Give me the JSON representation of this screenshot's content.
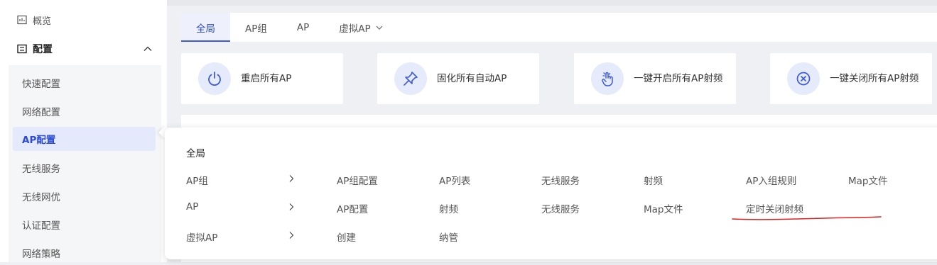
{
  "sidebar": {
    "overview_label": "概览",
    "config_group_label": "配置",
    "items": [
      {
        "label": "快速配置"
      },
      {
        "label": "网络配置"
      },
      {
        "label": "AP配置"
      },
      {
        "label": "无线服务"
      },
      {
        "label": "无线网优"
      },
      {
        "label": "认证配置"
      },
      {
        "label": "网络策略"
      }
    ],
    "active_item": "AP配置"
  },
  "tabs": [
    {
      "label": "全局",
      "active": true
    },
    {
      "label": "AP组"
    },
    {
      "label": "AP"
    },
    {
      "label": "虚拟AP",
      "has_dropdown": true
    }
  ],
  "actions": [
    {
      "label": "重启所有AP",
      "icon": "power-icon"
    },
    {
      "label": "固化所有自动AP",
      "icon": "pin-icon"
    },
    {
      "label": "一键开启所有AP射频",
      "icon": "tap-hand-icon"
    },
    {
      "label": "一键关闭所有AP射频",
      "icon": "close-circle-icon"
    }
  ],
  "menu": {
    "title": "全局",
    "rows": [
      {
        "label": "AP组",
        "links": [
          "AP组配置",
          "AP列表",
          "无线服务",
          "射频",
          "AP入组规则",
          "Map文件"
        ]
      },
      {
        "label": "AP",
        "links": [
          "AP配置",
          "射频",
          "无线服务",
          "Map文件",
          "定时关闭射频"
        ]
      },
      {
        "label": "虚拟AP",
        "links": [
          "创建",
          "纳管"
        ]
      }
    ]
  },
  "colors": {
    "accent": "#3d5bdc",
    "active_bg": "#e4e9fb",
    "annotation_red": "#e02020"
  }
}
